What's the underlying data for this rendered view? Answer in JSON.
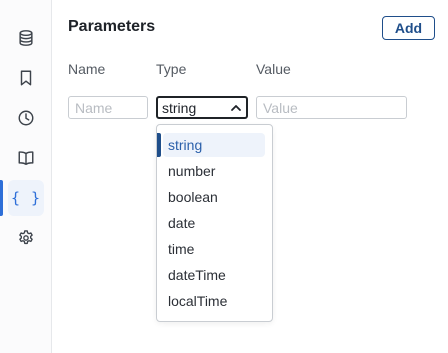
{
  "sidebar": {
    "items": [
      {
        "icon": "database-icon"
      },
      {
        "icon": "bookmark-icon"
      },
      {
        "icon": "clock-icon"
      },
      {
        "icon": "book-icon"
      },
      {
        "icon": "braces-icon",
        "glyph": "{ }",
        "active": true
      },
      {
        "icon": "gear-icon"
      }
    ]
  },
  "header": {
    "title": "Parameters",
    "add_label": "Add"
  },
  "columns": {
    "name": "Name",
    "type": "Type",
    "value": "Value"
  },
  "row": {
    "name_placeholder": "Name",
    "type_value": "string",
    "value_placeholder": "Value"
  },
  "dropdown": {
    "options": [
      "string",
      "number",
      "boolean",
      "date",
      "time",
      "dateTime",
      "localTime"
    ],
    "selected": "string"
  },
  "colors": {
    "accent": "#1f4e8a",
    "accent_light": "#eef3fb",
    "sidebar_active": "#2e6fd8"
  }
}
